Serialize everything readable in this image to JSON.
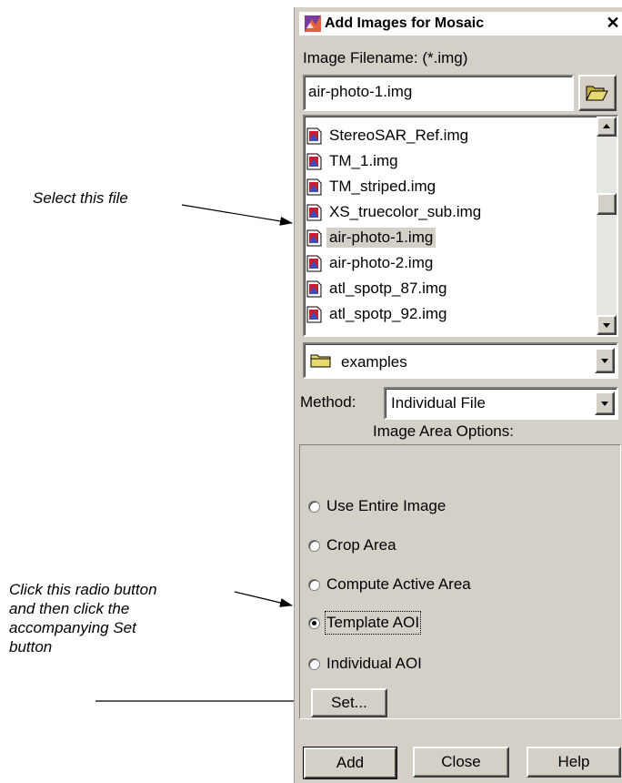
{
  "annotations": {
    "select_file": "Select this file",
    "click_radio_lines": [
      "Click this radio button",
      "and then click the",
      "accompanying Set",
      "button"
    ]
  },
  "dialog": {
    "title": "Add Images for Mosaic",
    "close_glyph": "✕",
    "filename_label": "Image Filename: (*.img)",
    "filename_value": "air-photo-1.img",
    "files": [
      {
        "name": "StereoSAR_Ref.img",
        "selected": false
      },
      {
        "name": "TM_1.img",
        "selected": false
      },
      {
        "name": "TM_striped.img",
        "selected": false
      },
      {
        "name": "XS_truecolor_sub.img",
        "selected": false
      },
      {
        "name": "air-photo-1.img",
        "selected": true
      },
      {
        "name": "air-photo-2.img",
        "selected": false
      },
      {
        "name": "atl_spotp_87.img",
        "selected": false
      },
      {
        "name": "atl_spotp_92.img",
        "selected": false
      }
    ],
    "directory": "examples",
    "method_label": "Method:",
    "method_value": "Individual File",
    "area_options_label": "Image Area Options:",
    "radio_options": [
      {
        "label": "Use Entire Image",
        "checked": false
      },
      {
        "label": "Crop Area",
        "checked": false
      },
      {
        "label": "Compute Active Area",
        "checked": false
      },
      {
        "label": "Template AOI",
        "checked": true
      },
      {
        "label": "Individual AOI",
        "checked": false
      }
    ],
    "set_label": "Set...",
    "add_label": "Add",
    "close_label": "Close",
    "help_label": "Help"
  },
  "icons": {
    "title": "mosaic-app-icon",
    "browse": "open-folder-icon",
    "file": "image-file-icon",
    "directory": "folder-icon",
    "dropdown": "dropdown-arrow-icon"
  },
  "colors": {
    "dialog_bg": "#d4d0c8",
    "selection_bg": "#d4d0c8"
  }
}
